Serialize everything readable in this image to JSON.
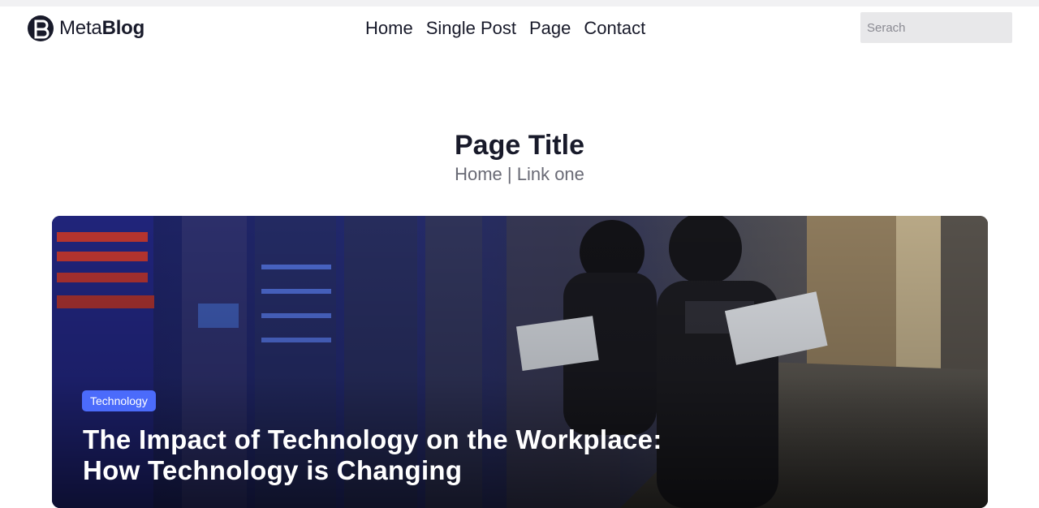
{
  "brand": {
    "name_regular": "Meta",
    "name_bold": "Blog"
  },
  "nav": {
    "items": [
      {
        "label": "Home"
      },
      {
        "label": "Single Post"
      },
      {
        "label": "Page"
      },
      {
        "label": "Contact"
      }
    ]
  },
  "search": {
    "placeholder": "Serach"
  },
  "header": {
    "title": "Page Title",
    "breadcrumb": {
      "home": "Home",
      "separator": " | ",
      "current": "Link one"
    }
  },
  "hero": {
    "category": "Technology",
    "title": "The Impact of Technology on the Workplace: How Technology is Changing",
    "image_icon": "photo-woman-with-laptop-in-server-room"
  },
  "colors": {
    "accent": "#4b6bfb",
    "text_dark": "#181a2a",
    "text_muted": "#696a75",
    "search_bg": "#e8e8ea"
  }
}
